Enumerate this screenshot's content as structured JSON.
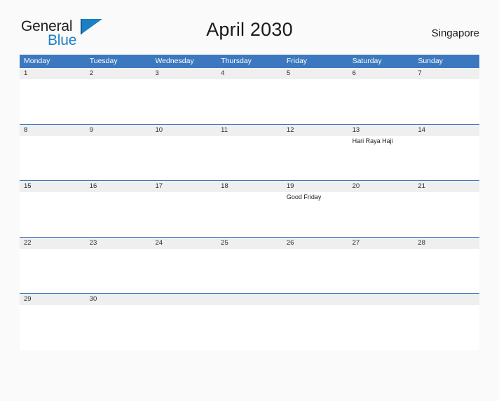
{
  "brand": {
    "name_part1": "General",
    "name_part2": "Blue",
    "flag_icon": "blue-flag-triangle-icon"
  },
  "header": {
    "title": "April 2030",
    "region": "Singapore"
  },
  "colors": {
    "header_blue": "#3b78bf",
    "date_band_gray": "#efefef",
    "brand_blue": "#1b7fc4",
    "page_background": "#fafafa"
  },
  "calendar": {
    "weekdays": [
      "Monday",
      "Tuesday",
      "Wednesday",
      "Thursday",
      "Friday",
      "Saturday",
      "Sunday"
    ],
    "weeks": [
      [
        {
          "date": "1",
          "event": ""
        },
        {
          "date": "2",
          "event": ""
        },
        {
          "date": "3",
          "event": ""
        },
        {
          "date": "4",
          "event": ""
        },
        {
          "date": "5",
          "event": ""
        },
        {
          "date": "6",
          "event": ""
        },
        {
          "date": "7",
          "event": ""
        }
      ],
      [
        {
          "date": "8",
          "event": ""
        },
        {
          "date": "9",
          "event": ""
        },
        {
          "date": "10",
          "event": ""
        },
        {
          "date": "11",
          "event": ""
        },
        {
          "date": "12",
          "event": ""
        },
        {
          "date": "13",
          "event": "Hari Raya Haji"
        },
        {
          "date": "14",
          "event": ""
        }
      ],
      [
        {
          "date": "15",
          "event": ""
        },
        {
          "date": "16",
          "event": ""
        },
        {
          "date": "17",
          "event": ""
        },
        {
          "date": "18",
          "event": ""
        },
        {
          "date": "19",
          "event": "Good Friday"
        },
        {
          "date": "20",
          "event": ""
        },
        {
          "date": "21",
          "event": ""
        }
      ],
      [
        {
          "date": "22",
          "event": ""
        },
        {
          "date": "23",
          "event": ""
        },
        {
          "date": "24",
          "event": ""
        },
        {
          "date": "25",
          "event": ""
        },
        {
          "date": "26",
          "event": ""
        },
        {
          "date": "27",
          "event": ""
        },
        {
          "date": "28",
          "event": ""
        }
      ],
      [
        {
          "date": "29",
          "event": ""
        },
        {
          "date": "30",
          "event": ""
        },
        {
          "date": "",
          "event": ""
        },
        {
          "date": "",
          "event": ""
        },
        {
          "date": "",
          "event": ""
        },
        {
          "date": "",
          "event": ""
        },
        {
          "date": "",
          "event": ""
        }
      ]
    ]
  }
}
